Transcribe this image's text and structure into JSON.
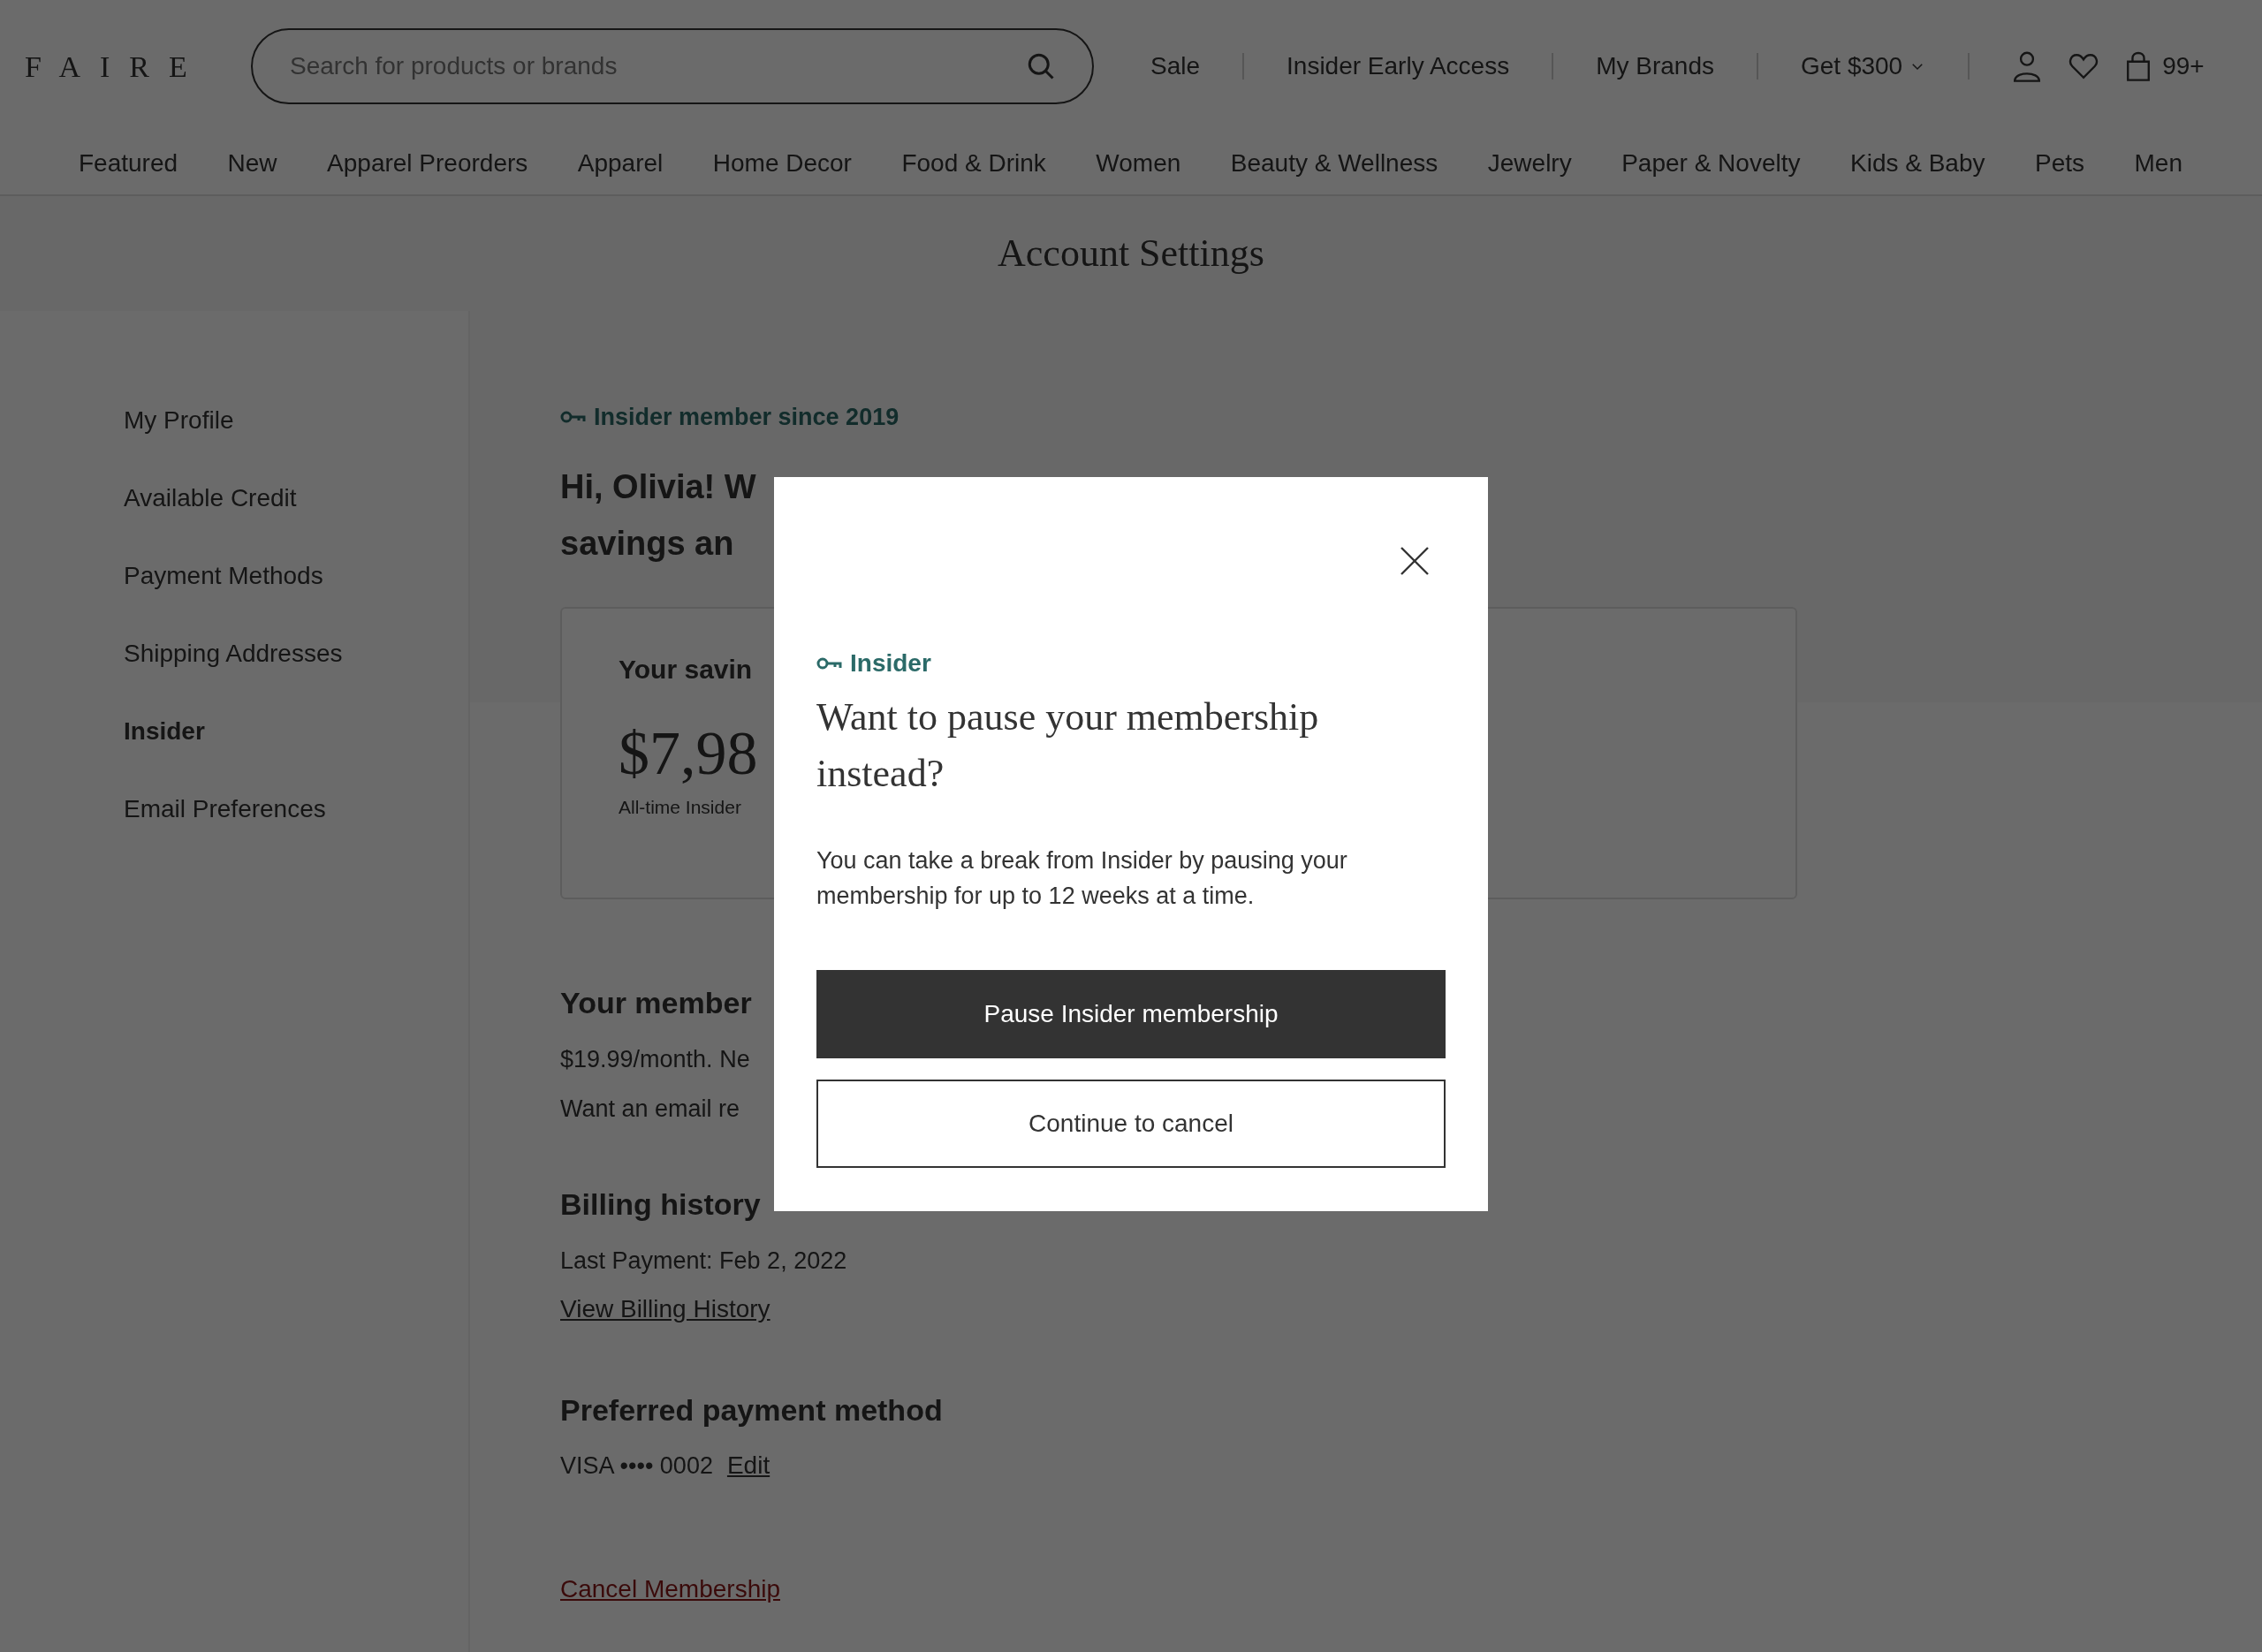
{
  "header": {
    "logo": "FAIRE",
    "search": {
      "placeholder": "Search for products or brands"
    },
    "links": [
      {
        "label": "Sale",
        "dropdown": false
      },
      {
        "label": "Insider Early Access",
        "dropdown": false
      },
      {
        "label": "My Brands",
        "dropdown": false
      },
      {
        "label": "Get $300",
        "dropdown": true
      }
    ],
    "cart_count": "99+"
  },
  "categories": [
    "Featured",
    "New",
    "Apparel Preorders",
    "Apparel",
    "Home Decor",
    "Food & Drink",
    "Women",
    "Beauty & Wellness",
    "Jewelry",
    "Paper & Novelty",
    "Kids & Baby",
    "Pets",
    "Men"
  ],
  "page_title": "Account Settings",
  "sidebar": {
    "items": [
      {
        "label": "My Profile",
        "selected": false
      },
      {
        "label": "Available Credit",
        "selected": false
      },
      {
        "label": "Payment Methods",
        "selected": false
      },
      {
        "label": "Shipping Addresses",
        "selected": false
      },
      {
        "label": "Insider",
        "selected": true
      },
      {
        "label": "Email Preferences",
        "selected": false
      }
    ]
  },
  "insider": {
    "badge": "Insider member since 2019",
    "greeting_lines": [
      "Hi, Olivia! W",
      "savings an"
    ],
    "savings_card": {
      "title": "Your savin",
      "amount": "$7,98",
      "caption": "All-time Insider"
    }
  },
  "membership": {
    "title": "Your member",
    "lines": [
      "$19.99/month. Ne",
      "Want an email re"
    ]
  },
  "billing": {
    "title": "Billing history",
    "last_payment": "Last Payment: Feb 2, 2022",
    "link": "View Billing History"
  },
  "payment": {
    "title": "Preferred payment method",
    "card": "VISA •••• 0002",
    "edit": "Edit"
  },
  "cancel_link": "Cancel Membership",
  "modal": {
    "tag": "Insider",
    "title": "Want to pause your membership instead?",
    "body": "You can take a break from Insider by pausing your membership for up to 12 weeks at a time.",
    "buttons": [
      {
        "label": "Pause Insider membership",
        "kind": "primary"
      },
      {
        "label": "Continue to cancel",
        "kind": "secondary"
      }
    ]
  }
}
